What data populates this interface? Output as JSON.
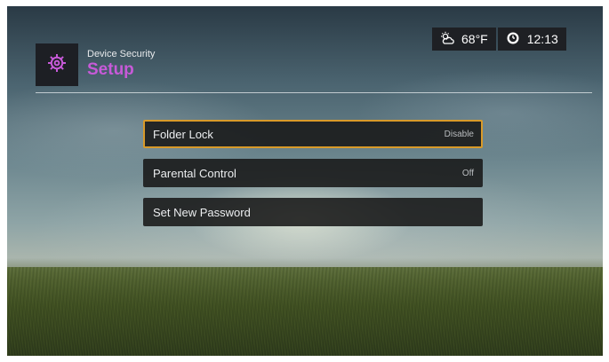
{
  "header": {
    "subtitle": "Device Security",
    "title": "Setup",
    "icon": "gear-icon",
    "title_color": "#c75ad8"
  },
  "status": {
    "weather_icon": "weather-cloud-sun-icon",
    "temperature": "68°F",
    "clock_icon": "clock-icon",
    "time": "12:13"
  },
  "menu": {
    "items": [
      {
        "label": "Folder Lock",
        "value": "Disable",
        "selected": true
      },
      {
        "label": "Parental Control",
        "value": "Off",
        "selected": false
      },
      {
        "label": "Set New Password",
        "value": "",
        "selected": false
      }
    ]
  },
  "colors": {
    "selection_border": "#d89a2a",
    "panel_background": "#1e2024"
  }
}
